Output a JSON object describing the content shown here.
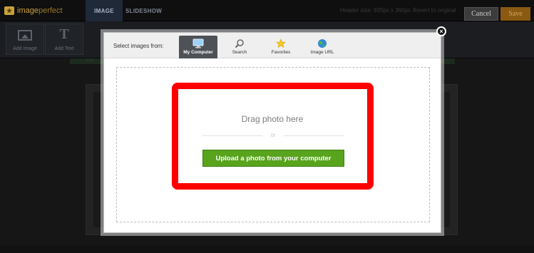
{
  "app": {
    "logo_text_1": "image",
    "logo_text_2": "perfect",
    "tabs": [
      {
        "label": "IMAGE",
        "active": true
      },
      {
        "label": "SLIDESHOW",
        "active": false
      }
    ],
    "header_size": "Header size: 920px x 360px",
    "revert_label": "Revert to original",
    "cancel_label": "Cancel",
    "save_label": "Save"
  },
  "toolbar": {
    "items": [
      {
        "label": "Add Image",
        "icon": "image-icon"
      },
      {
        "label": "Add Text",
        "icon": "text-icon",
        "glyph": "T"
      }
    ]
  },
  "canvas": {
    "strip_text": "1 / 1"
  },
  "modal": {
    "select_label": "Select images from:",
    "tabs": [
      {
        "label": "My Computer",
        "icon": "monitor-icon",
        "active": true
      },
      {
        "label": "Search",
        "icon": "magnifier-icon",
        "active": false
      },
      {
        "label": "Favorites",
        "icon": "star-icon",
        "active": false
      },
      {
        "label": "Image URL",
        "icon": "globe-icon",
        "active": false
      }
    ],
    "drag_text": "Drag photo here",
    "or_text": "or",
    "upload_label": "Upload a photo from your computer",
    "close_glyph": "×"
  },
  "colors": {
    "accent_green": "#58a41d",
    "highlight_red": "#ff0000",
    "save_orange": "#8a5a12"
  }
}
